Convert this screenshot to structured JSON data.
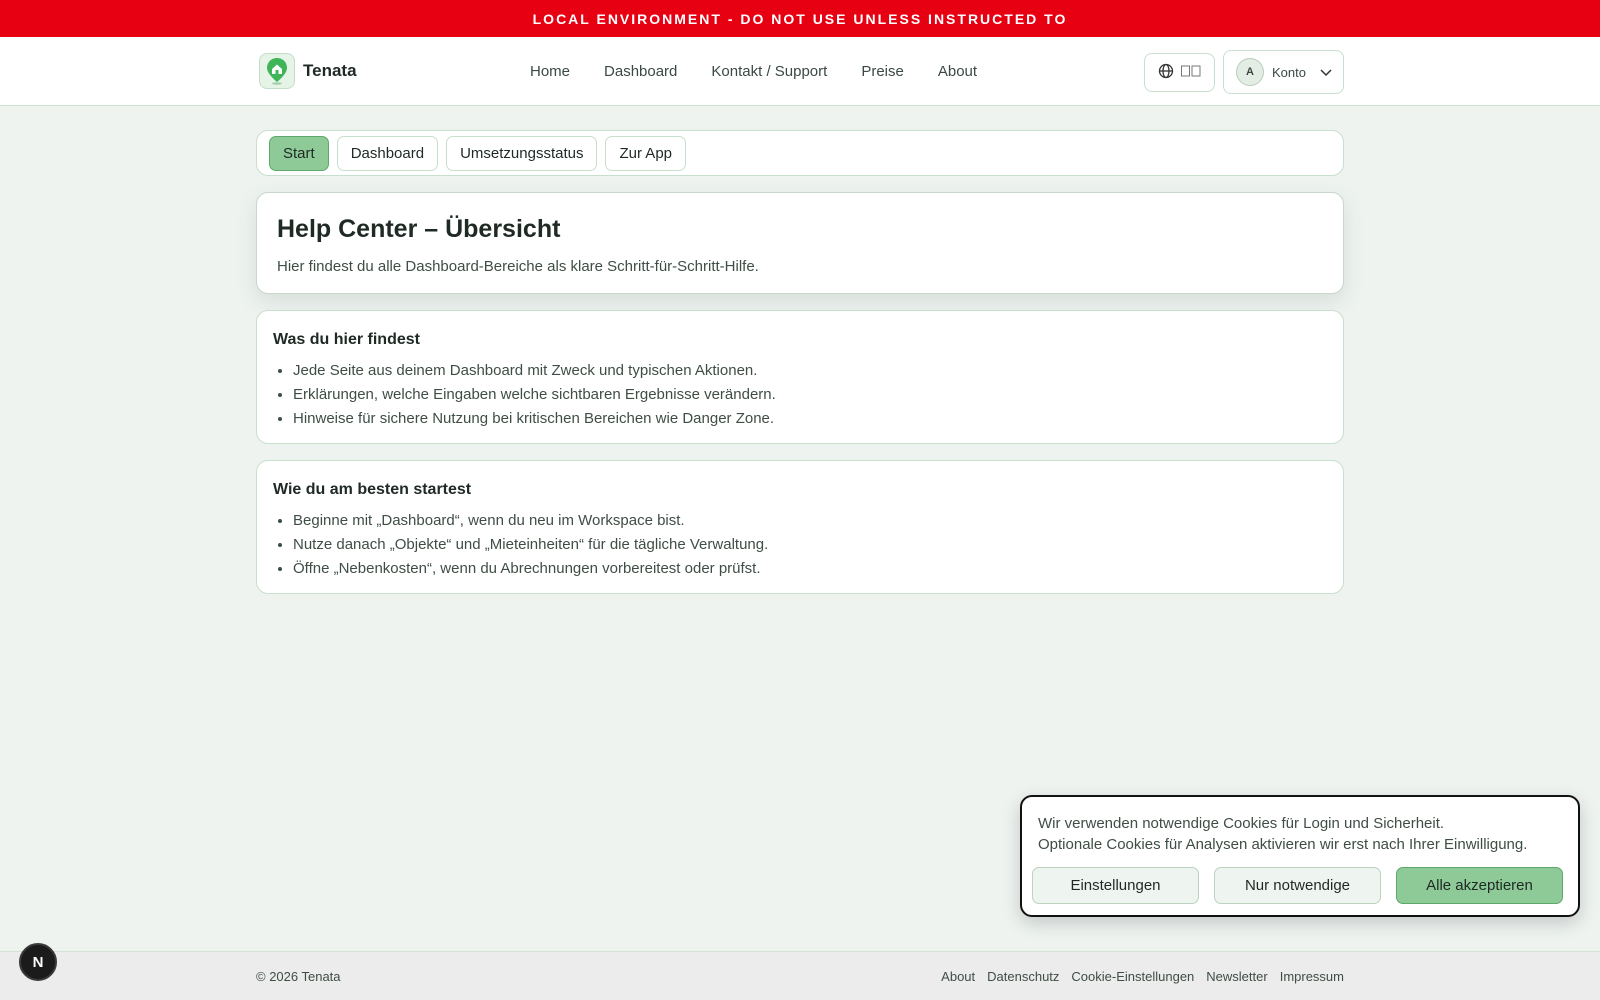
{
  "env_banner": "LOCAL ENVIRONMENT - DO NOT USE UNLESS INSTRUCTED TO",
  "brand": {
    "name": "Tenata",
    "logo_icon": "house-pin-icon"
  },
  "nav": {
    "links": [
      "Home",
      "Dashboard",
      "Kontakt / Support",
      "Preise",
      "About"
    ],
    "lang_label": "",
    "account": {
      "avatar": "A",
      "label": "Konto"
    }
  },
  "tabs": [
    {
      "label": "Start",
      "active": true
    },
    {
      "label": "Dashboard",
      "active": false
    },
    {
      "label": "Umsetzungsstatus",
      "active": false
    },
    {
      "label": "Zur App",
      "active": false
    }
  ],
  "hero": {
    "title": "Help Center – Übersicht",
    "subtitle": "Hier findest du alle Dashboard-Bereiche als klare Schritt-für-Schritt-Hilfe."
  },
  "cards": [
    {
      "title": "Was du hier findest",
      "items": [
        "Jede Seite aus deinem Dashboard mit Zweck und typischen Aktionen.",
        "Erklärungen, welche Eingaben welche sichtbaren Ergebnisse verändern.",
        "Hinweise für sichere Nutzung bei kritischen Bereichen wie Danger Zone."
      ]
    },
    {
      "title": "Wie du am besten startest",
      "items": [
        "Beginne mit „Dashboard“, wenn du neu im Workspace bist.",
        "Nutze danach „Objekte“ und „Mieteinheiten“ für die tägliche Verwaltung.",
        "Öffne „Nebenkosten“, wenn du Abrechnungen vorbereitest oder prüfst."
      ]
    }
  ],
  "cookie": {
    "line1": "Wir verwenden notwendige Cookies für Login und Sicherheit.",
    "line2": "Optionale Cookies für Analysen aktivieren wir erst nach Ihrer Einwilligung.",
    "settings": "Einstellungen",
    "necessary": "Nur notwendige",
    "accept_all": "Alle akzeptieren"
  },
  "footer": {
    "copyright": "© 2026 Tenata",
    "links": [
      "About",
      "Datenschutz",
      "Cookie-Einstellungen",
      "Newsletter",
      "Impressum"
    ]
  },
  "next_badge": "N",
  "colors": {
    "banner": "#e60012",
    "accent": "#8ec998",
    "accent_border": "#5ea86b"
  }
}
